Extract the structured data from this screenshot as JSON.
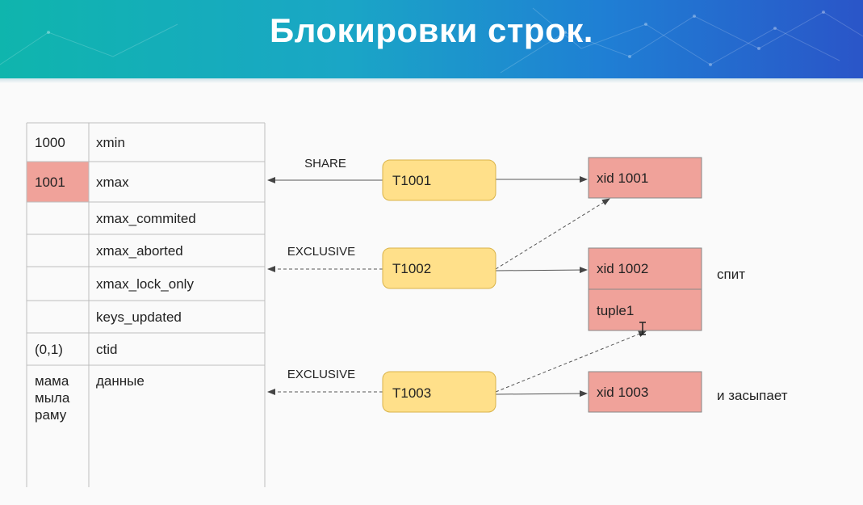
{
  "title": "Блокировки строк.",
  "colors": {
    "banner_left": "#0fb5ad",
    "banner_right": "#2a55c8",
    "transaction": "#ffe08a",
    "lock": "#f0a29a"
  },
  "tuple_rows": [
    {
      "value": "1000",
      "field": "xmin",
      "highlight": false
    },
    {
      "value": "1001",
      "field": "xmax",
      "highlight": true
    },
    {
      "value": "",
      "field": "xmax_commited",
      "highlight": false
    },
    {
      "value": "",
      "field": "xmax_aborted",
      "highlight": false
    },
    {
      "value": "",
      "field": "xmax_lock_only",
      "highlight": false
    },
    {
      "value": "",
      "field": "keys_updated",
      "highlight": false
    },
    {
      "value": "(0,1)",
      "field": "ctid",
      "highlight": false
    },
    {
      "value": "мама\nмыла\nраму",
      "field": "данные",
      "highlight": false
    }
  ],
  "transactions": [
    {
      "name": "T1001",
      "mode": "SHARE"
    },
    {
      "name": "T1002",
      "mode": "EXCLUSIVE"
    },
    {
      "name": "T1003",
      "mode": "EXCLUSIVE"
    }
  ],
  "locks": {
    "xid1001": "xid 1001",
    "xid1002": "xid 1002",
    "tuple1": "tuple1",
    "xid1003": "xid 1003"
  },
  "notes": {
    "sleeps": "спит",
    "falls_asleep": "и засыпает"
  }
}
